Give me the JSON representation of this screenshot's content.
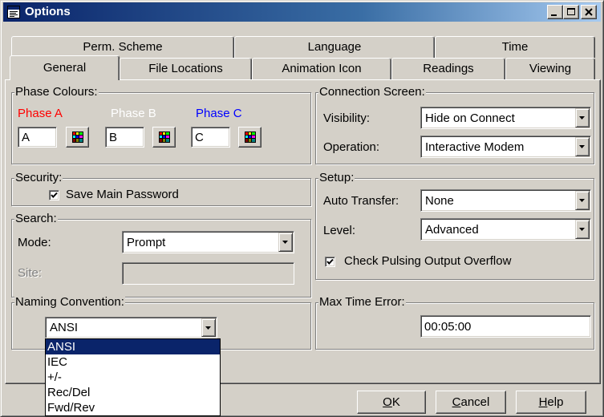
{
  "window": {
    "title": "Options"
  },
  "icons": {
    "app": "options-window-icon",
    "minimize": "minimize-icon",
    "maximize": "maximize-icon",
    "close": "close-icon",
    "color_button": "color-palette-icon",
    "dropdown": "chevron-down-icon",
    "check": "checkmark-icon"
  },
  "colors": {
    "phase_a": "#ff0000",
    "phase_b": "#ffffff",
    "phase_c": "#0000ff",
    "title_bar": "#0a246a",
    "selection": "#0a246a"
  },
  "tabs": {
    "row1": [
      {
        "label": "Perm. Scheme"
      },
      {
        "label": "Language"
      },
      {
        "label": "Time"
      }
    ],
    "row2": [
      {
        "label": "General",
        "selected": true
      },
      {
        "label": "File Locations"
      },
      {
        "label": "Animation Icon"
      },
      {
        "label": "Readings"
      },
      {
        "label": "Viewing"
      }
    ]
  },
  "phase_colours": {
    "legend": "Phase Colours:",
    "phases": [
      {
        "label": "Phase A",
        "value": "A"
      },
      {
        "label": "Phase B",
        "value": "B"
      },
      {
        "label": "Phase C",
        "value": "C"
      }
    ]
  },
  "connection_screen": {
    "legend": "Connection Screen:",
    "visibility_label": "Visibility:",
    "visibility_value": "Hide on Connect",
    "operation_label": "Operation:",
    "operation_value": "Interactive Modem"
  },
  "security": {
    "legend": "Security:",
    "save_password_label": "Save Main Password",
    "save_password_checked": true
  },
  "setup": {
    "legend": "Setup:",
    "auto_transfer_label": "Auto Transfer:",
    "auto_transfer_value": "None",
    "level_label": "Level:",
    "level_value": "Advanced",
    "check_pulsing_label": "Check Pulsing Output Overflow",
    "check_pulsing_checked": true
  },
  "search": {
    "legend": "Search:",
    "mode_label": "Mode:",
    "mode_value": "Prompt",
    "site_label": "Site:"
  },
  "naming_convention": {
    "legend": "Naming Convention:",
    "value": "ANSI",
    "options": [
      "ANSI",
      "IEC",
      "+/-",
      "Rec/Del",
      "Fwd/Rev"
    ],
    "selected_index": 0
  },
  "max_time_error": {
    "legend": "Max Time Error:",
    "value": "00:05:00"
  },
  "buttons": {
    "ok": {
      "accel": "O",
      "rest": "K"
    },
    "cancel": {
      "accel": "C",
      "rest": "ancel"
    },
    "help": {
      "accel": "H",
      "rest": "elp"
    }
  }
}
